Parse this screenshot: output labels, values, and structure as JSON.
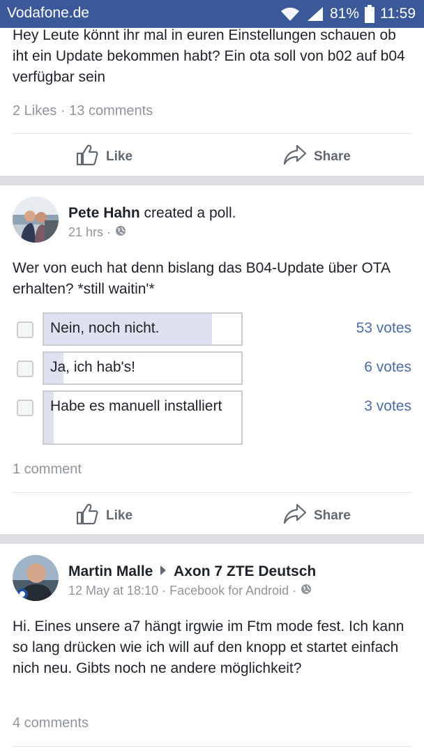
{
  "status_bar": {
    "carrier": "Vodafone.de",
    "battery": "81%",
    "time": "11:59"
  },
  "post1": {
    "text": "Hey Leute könnt ihr mal in euren Einstellungen schauen ob iht ein Update bekommen habt? Ein ota soll von b02 auf b04 verfügbar sein",
    "stats": "2 Likes · 13 comments",
    "like_label": "Like",
    "share_label": "Share"
  },
  "post2": {
    "author": "Pete Hahn",
    "action": "created a poll.",
    "time": "21 hrs ·",
    "question": "Wer von euch hat denn bislang das B04-Update über OTA erhalten? *still waitin'*",
    "options": [
      {
        "label": "Nein, noch nicht.",
        "votes": "53 votes",
        "fraction": 0.85
      },
      {
        "label": "Ja, ich hab's!",
        "votes": "6 votes",
        "fraction": 0.1
      },
      {
        "label": "Habe es manuell installiert",
        "votes": "3 votes",
        "fraction": 0.05
      }
    ],
    "stats": "1 comment",
    "like_label": "Like",
    "share_label": "Share"
  },
  "post3": {
    "author": "Martin Malle",
    "group": "Axon 7 ZTE Deutsch",
    "time": "12 May at 18:10 · Facebook for Android ·",
    "text": "Hi. Eines unsere a7 hängt irgwie im Ftm mode fest. Ich kann so lang drücken wie ich will auf den knopp et startet einfach nich neu. Gibts noch ne andere möglichkeit?",
    "stats": "4 comments"
  },
  "colors": {
    "status_bar": "#3b5998",
    "vote_link": "#4b6ca8",
    "poll_fill": "#dde2ee"
  }
}
